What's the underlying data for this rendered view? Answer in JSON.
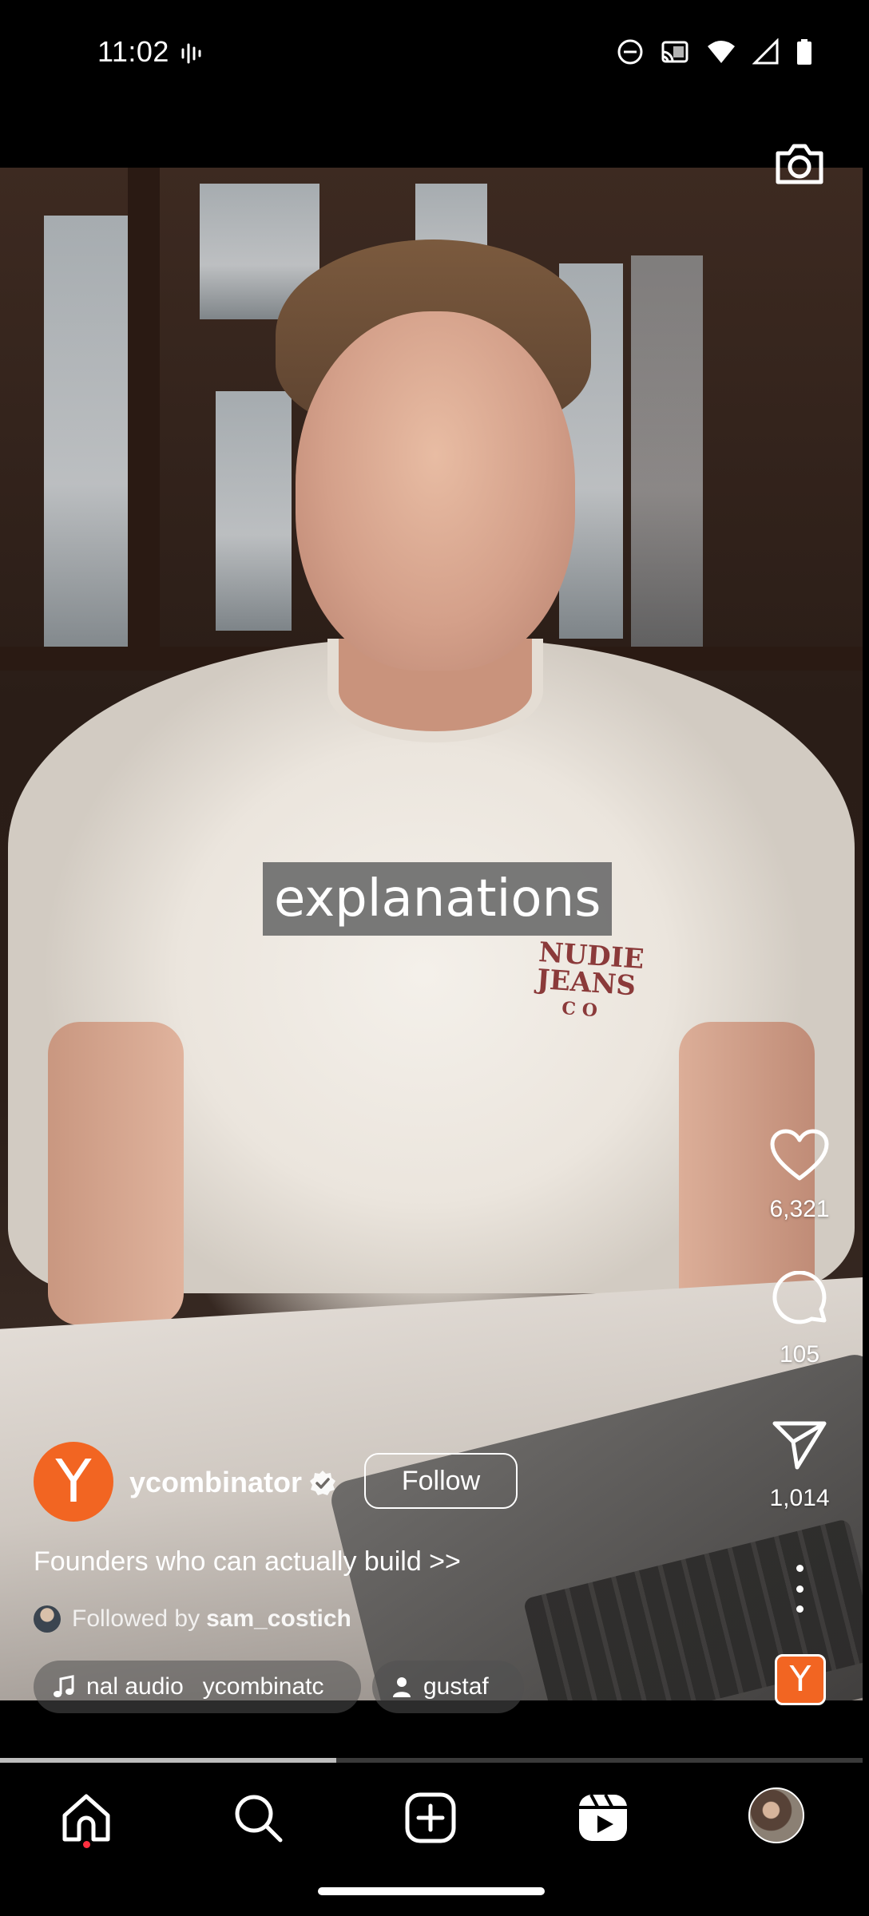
{
  "status_bar": {
    "time": "11:02"
  },
  "video": {
    "caption_overlay": "explanations",
    "shirt_logo": {
      "line1": "NUDIE",
      "line2": "JEANS",
      "line3": "CO"
    },
    "progress": 0.39
  },
  "actions": {
    "like_count": "6,321",
    "comment_count": "105",
    "share_count": "1,014"
  },
  "author": {
    "avatar_letter": "Y",
    "username": "ycombinator",
    "follow_label": "Follow",
    "brand_color": "#f26522"
  },
  "post": {
    "caption": "Founders who can actually build >>",
    "followed_by_prefix": "Followed by",
    "followed_by_user": "sam_costich",
    "audio_label": "nal audio",
    "audio_author": "ycombinatc",
    "tagged_user": "gustaf",
    "audio_thumb_letter": "Y"
  },
  "nav": {
    "items": [
      "home-icon",
      "search-icon",
      "create-icon",
      "reels-icon",
      "profile-avatar"
    ]
  }
}
